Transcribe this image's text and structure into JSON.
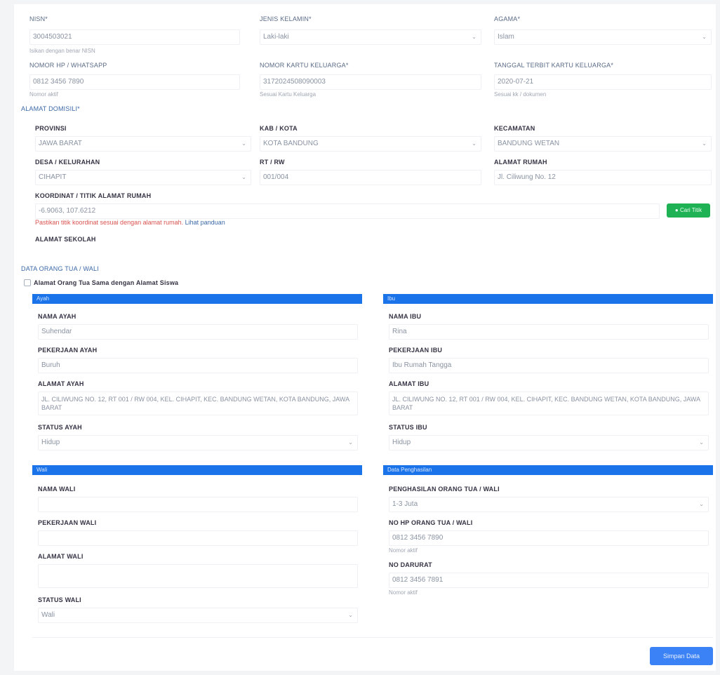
{
  "top_fields": [
    {
      "label": "NISN*",
      "value": "3004503021",
      "hint": "Isikan dengan benar NISN"
    },
    {
      "label": "JENIS KELAMIN*",
      "value": "Laki-laki"
    },
    {
      "label": "AGAMA*",
      "value": "Islam"
    },
    {
      "label": "NOMOR HP / WHATSAPP",
      "value": "0812 3456 7890",
      "hint": "Nomor aktif"
    },
    {
      "label": "NOMOR KARTU KELUARGA*",
      "value": "3172024508090003",
      "hint": "Sesuai Kartu Keluarga"
    },
    {
      "label": "TANGGAL TERBIT KARTU KELUARGA*",
      "value": "2020-07-21",
      "hint": "Sesuai kk / dokumen"
    }
  ],
  "alamat": {
    "section_label": "ALAMAT DOMISILI*",
    "fields": [
      {
        "label": "PROVINSI",
        "value": "JAWA BARAT"
      },
      {
        "label": "KAB / KOTA",
        "value": "KOTA BANDUNG"
      },
      {
        "label": "KECAMATAN",
        "value": "BANDUNG WETAN"
      },
      {
        "label": "DESA / KELURAHAN",
        "value": "CIHAPIT"
      },
      {
        "label": "RT / RW",
        "value": "001/004"
      },
      {
        "label": "ALAMAT RUMAH",
        "value": "Jl. Ciliwung No. 12"
      }
    ],
    "koordinat_label": "KOORDINAT / TITIK ALAMAT RUMAH",
    "koordinat_value": "-6.9063, 107.6212",
    "koordinat_button": "Cari Titik",
    "warning_red": "Pastikan titik koordinat sesuai dengan alamat rumah.",
    "warning_blue": "Lihat panduan",
    "alamat_sekolah_label": "ALAMAT SEKOLAH"
  },
  "ortu": {
    "section_label": "DATA ORANG TUA / WALI",
    "checkbox_label": "Alamat Orang Tua Sama dengan Alamat Siswa",
    "ayah": {
      "title": "Ayah",
      "nama_label": "NAMA AYAH",
      "nama_value": "Suhendar",
      "pekerjaan_label": "PEKERJAAN AYAH",
      "pekerjaan_value": "Buruh",
      "alamat_label": "ALAMAT AYAH",
      "alamat_value": "JL. CILIWUNG NO. 12, RT 001 / RW 004, KEL. CIHAPIT, KEC. BANDUNG WETAN, KOTA BANDUNG, JAWA BARAT",
      "status_label": "STATUS AYAH",
      "status_value": "Hidup"
    },
    "ibu": {
      "title": "Ibu",
      "nama_label": "NAMA IBU",
      "nama_value": "Rina",
      "pekerjaan_label": "PEKERJAAN IBU",
      "pekerjaan_value": "Ibu Rumah Tangga",
      "alamat_label": "ALAMAT IBU",
      "alamat_value": "JL. CILIWUNG NO. 12, RT 001 / RW 004, KEL. CIHAPIT, KEC. BANDUNG WETAN, KOTA BANDUNG, JAWA BARAT",
      "status_label": "STATUS IBU",
      "status_value": "Hidup"
    },
    "wali": {
      "title": "Wali",
      "nama_label": "NAMA WALI",
      "pekerjaan_label": "PEKERJAAN WALI",
      "alamat_label": "ALAMAT WALI",
      "status_label": "STATUS WALI",
      "status_value": "Wali"
    },
    "ekonomi": {
      "title": "Data Penghasilan",
      "penghasilan_label": "PENGHASILAN ORANG TUA / WALI",
      "penghasilan_value": "1-3 Juta",
      "no_hp_ortu_label": "NO HP ORANG TUA / WALI",
      "no_hp_ortu_value": "0812 3456 7890",
      "no_hp_ortu_hint": "Nomor aktif",
      "no_hp_darurat_label": "NO DARURAT",
      "no_hp_darurat_value": "0812 3456 7891",
      "no_hp_darurat_hint": "Nomor aktif"
    }
  },
  "submit_label": "Simpan Data"
}
